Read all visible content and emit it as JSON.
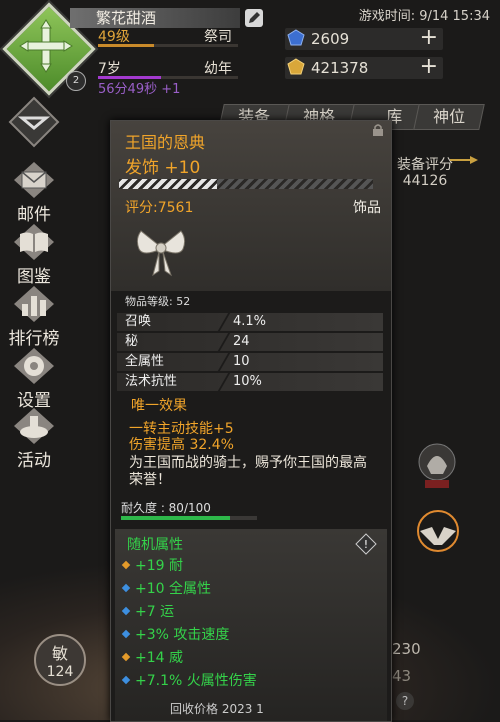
{
  "header": {
    "player_name": "繁花甜酒",
    "level": "49级",
    "class": "祭司",
    "age": "7岁",
    "stage": "幼年",
    "timer": "56分49秒 +1",
    "avatar_level": "2",
    "game_time": "游戏时间: 9/14 15:34"
  },
  "currencies": [
    {
      "name": "blue-gem",
      "value": "2609",
      "color": "#3c6fd1"
    },
    {
      "name": "gold-gem",
      "value": "421378",
      "color": "#d9a73a"
    }
  ],
  "tabs": [
    "装备",
    "神格",
    "… 库",
    "神位"
  ],
  "nav": [
    {
      "label": "邮件",
      "icon": "mail-icon"
    },
    {
      "label": "图鉴",
      "icon": "book-icon"
    },
    {
      "label": "排行榜",
      "icon": "ranking-icon"
    },
    {
      "label": "设置",
      "icon": "gear-icon"
    },
    {
      "label": "活动",
      "icon": "activity-icon"
    }
  ],
  "equip_score": {
    "label": "装备评分",
    "value": "44126"
  },
  "item": {
    "name": "王国的恩典",
    "enhance": "发饰 +10",
    "score": "评分:7561",
    "type": "饰品",
    "item_level": "物品等级: 52",
    "stats": [
      {
        "k": "召唤",
        "v": "4.1%"
      },
      {
        "k": "秘",
        "v": "24"
      },
      {
        "k": "全属性",
        "v": "10"
      },
      {
        "k": "法术抗性",
        "v": "10%"
      }
    ],
    "unique_title": "唯一效果",
    "unique_lines": [
      "一转主动技能+5",
      "伤害提高 32.4%"
    ],
    "flavor": "为王国而战的骑士，赐予你王国的最高荣誉！",
    "durability_label": "耐久度 : 80/100",
    "durability": 0.8,
    "random_title": "随机属性",
    "random_stats": [
      {
        "text": "+19 耐",
        "color": "#e39a2a"
      },
      {
        "text": "+10 全属性",
        "color": "#3d8fe0"
      },
      {
        "text": "+7 运",
        "color": "#3d8fe0"
      },
      {
        "text": "+3% 攻击速度",
        "color": "#3d8fe0"
      },
      {
        "text": "+14 威",
        "color": "#e39a2a"
      },
      {
        "text": "+7.1% 火属性伤害",
        "color": "#3d8fe0"
      }
    ],
    "recycle": "回收价格   2023      1"
  },
  "agility": {
    "label": "敏",
    "value": "124"
  },
  "side_values": [
    "230",
    "43"
  ]
}
